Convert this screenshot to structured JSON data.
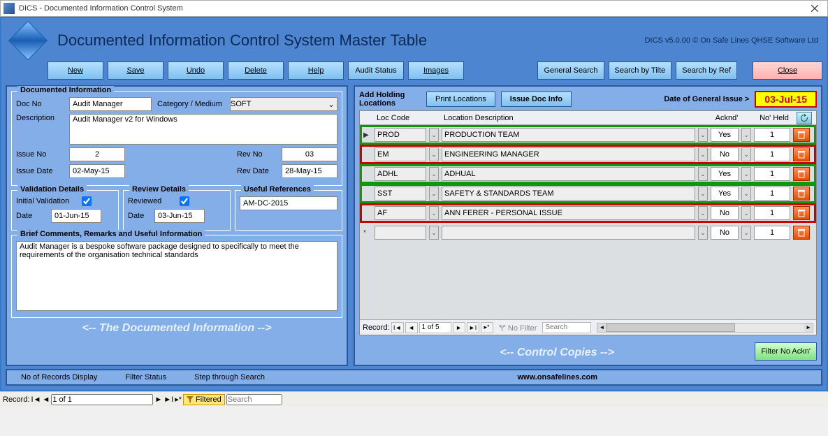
{
  "window": {
    "title": "DICS - Documented Information Control System"
  },
  "header": {
    "title": "Documented Information Control System Master Table",
    "version": "DICS v5.0.00 © On Safe Lines QHSE Software Ltd"
  },
  "toolbar": {
    "new": "New",
    "save": "Save",
    "undo": "Undo",
    "delete": "Delete",
    "help": "Help",
    "audit_status": "Audit Status",
    "images": "Images",
    "general_search": "General Search",
    "search_title": "Search by Tilte",
    "search_ref": "Search by Ref",
    "close": "Close"
  },
  "docinfo": {
    "legend": "Documented Information",
    "docno_lbl": "Doc No",
    "docno": "Audit Manager",
    "cat_lbl": "Category / Medium",
    "cat": "SOFT",
    "desc_lbl": "Description",
    "desc": "Audit Manager v2 for Windows",
    "issueno_lbl": "Issue No",
    "issueno": "2",
    "revno_lbl": "Rev No",
    "revno": "03",
    "issuedate_lbl": "Issue Date",
    "issuedate": "02-May-15",
    "revdate_lbl": "Rev Date",
    "revdate": "28-May-15"
  },
  "validation": {
    "legend": "Validation Details",
    "initial_lbl": "Initial Validation",
    "initial": true,
    "date_lbl": "Date",
    "date": "01-Jun-15"
  },
  "review": {
    "legend": "Review Details",
    "reviewed_lbl": "Reviewed",
    "reviewed": true,
    "date_lbl": "Date",
    "date": "03-Jun-15"
  },
  "refs": {
    "legend": "Useful References",
    "ref": "AM-DC-2015"
  },
  "comments": {
    "legend": "Brief Comments, Remarks and Useful Information",
    "text": "Audit Manager is a bespoke software package designed to specifically to meet the requirements of the organisation technical standards"
  },
  "leftfooter": "<-- The Documented Information -->",
  "right": {
    "addloc_lbl": "Add Holding Locations",
    "print_btn": "Print Locations",
    "issue_btn": "Issue Doc Info",
    "doi_lbl": "Date of General Issue  >",
    "doi": "03-Jul-15",
    "columns": {
      "loc": "Loc Code",
      "desc": "Location Description",
      "ack": "Acknd'",
      "held": "No' Held"
    },
    "rows": [
      {
        "code": "PROD",
        "desc": "PRODUCTION TEAM",
        "ack": "Yes",
        "held": "1",
        "status": "green"
      },
      {
        "code": "EM",
        "desc": "ENGINEERING MANAGER",
        "ack": "No",
        "held": "1",
        "status": "red"
      },
      {
        "code": "ADHL",
        "desc": "ADHUAL",
        "ack": "Yes",
        "held": "1",
        "status": "green"
      },
      {
        "code": "SST",
        "desc": "SAFETY & STANDARDS TEAM",
        "ack": "Yes",
        "held": "1",
        "status": "green"
      },
      {
        "code": "AF",
        "desc": "ANN FERER - PERSONAL ISSUE",
        "ack": "No",
        "held": "1",
        "status": "red"
      }
    ],
    "newrow": {
      "ack": "No",
      "held": "1"
    },
    "recnav": {
      "label": "Record:",
      "pos": "1 of 5",
      "filter": "No Filter",
      "search_ph": "Search"
    },
    "footer": "<-- Control Copies -->",
    "filter_btn": "Filter No Ackn'"
  },
  "bottominfo": {
    "rec_display": "No of Records Display",
    "filter_status": "Filter Status",
    "step": "Step through Search",
    "website": "www.onsafelines.com"
  },
  "bottomnav": {
    "label": "Record:",
    "pos": "1 of 1",
    "filtered": "Filtered",
    "search_ph": "Search"
  }
}
